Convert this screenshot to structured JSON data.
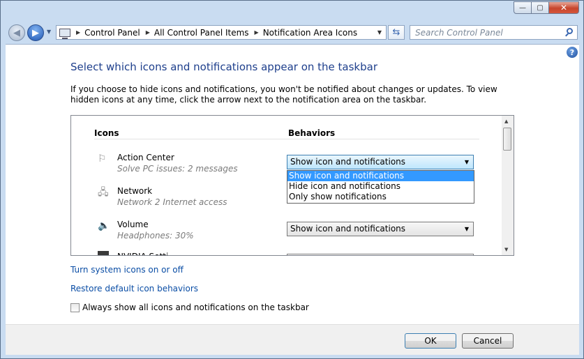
{
  "window": {
    "caption_buttons": {
      "minimize": "—",
      "maximize": "▢",
      "close": "✕"
    }
  },
  "nav": {
    "back_glyph": "◀",
    "forward_glyph": "▶",
    "history_glyph": "▼",
    "breadcrumbs": [
      "Control Panel",
      "All Control Panel Items",
      "Notification Area Icons"
    ],
    "address_dropdown_glyph": "▼",
    "refresh_glyph": "⇆",
    "search_placeholder": "Search Control Panel"
  },
  "help_glyph": "?",
  "page": {
    "heading": "Select which icons and notifications appear on the taskbar",
    "description": "If you choose to hide icons and notifications, you won't be notified about changes or updates. To view hidden icons at any time, click the arrow next to the notification area on the taskbar."
  },
  "list": {
    "col_icons": "Icons",
    "col_behaviors": "Behaviors",
    "rows": [
      {
        "icon": "flag-icon",
        "icon_glyph": "⚐",
        "name": "Action Center",
        "sub": "Solve PC issues: 2 messages",
        "behavior": "Show icon and notifications"
      },
      {
        "icon": "network-icon",
        "icon_glyph": "🖧",
        "name": "Network",
        "sub": "Network  2 Internet access",
        "behavior": ""
      },
      {
        "icon": "speaker-icon",
        "icon_glyph": "🔈",
        "name": "Volume",
        "sub": "Headphones: 30%",
        "behavior": "Show icon and notifications"
      },
      {
        "icon": "nvidia-icon",
        "name": "NVIDIA Setti..."
      }
    ],
    "dropdown_options": [
      "Show icon and notifications",
      "Hide icon and notifications",
      "Only show notifications"
    ],
    "dropdown_selected": "Show icon and notifications",
    "combo_arrow": "▼",
    "scroll_up": "▲",
    "scroll_down": "▼"
  },
  "links": {
    "system_icons": "Turn system icons on or off",
    "restore_defaults": "Restore default icon behaviors"
  },
  "checkbox": {
    "label": "Always show all icons and notifications on the taskbar",
    "checked": false
  },
  "buttons": {
    "ok": "OK",
    "cancel": "Cancel"
  }
}
